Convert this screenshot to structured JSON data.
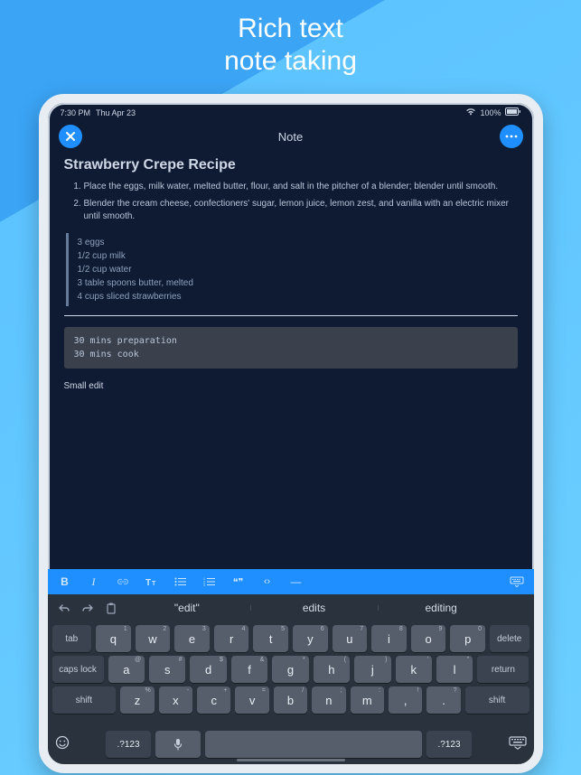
{
  "promo": {
    "line1": "Rich text",
    "line2": "note taking"
  },
  "status": {
    "time": "7:30 PM",
    "date": "Thu Apr 23",
    "battery_pct": "100%"
  },
  "nav": {
    "title": "Note"
  },
  "note": {
    "title": "Strawberry Crepe Recipe",
    "steps": [
      "Place the eggs, milk water, melted butter, flour, and salt in the pitcher of a blender; blender until smooth.",
      "Blender the cream cheese, confectioners' sugar, lemon juice, lemon zest, and vanilla with an electric mixer until smooth."
    ],
    "ingredients": [
      "3 eggs",
      "1/2 cup milk",
      "1/2 cup water",
      "3 table spoons butter, melted",
      "4 cups sliced strawberries"
    ],
    "code": "30 mins preparation\n30 mins cook",
    "footer": "Small edit"
  },
  "toolbar": {
    "bold": "B",
    "italic": "I",
    "quote": "❝❞",
    "code": "‹›",
    "hr": "—"
  },
  "suggestions": {
    "s1": "\"edit\"",
    "s2": "edits",
    "s3": "editing"
  },
  "keyboard": {
    "row1": [
      "q",
      "w",
      "e",
      "r",
      "t",
      "y",
      "u",
      "i",
      "o",
      "p"
    ],
    "row1_sub": [
      "1",
      "2",
      "3",
      "4",
      "5",
      "6",
      "7",
      "8",
      "9",
      "0"
    ],
    "row2": [
      "a",
      "s",
      "d",
      "f",
      "g",
      "h",
      "j",
      "k",
      "l"
    ],
    "row2_sub": [
      "@",
      "#",
      "$",
      "&",
      "*",
      "(",
      ")",
      "'",
      "\""
    ],
    "row3": [
      "z",
      "x",
      "c",
      "v",
      "b",
      "n",
      "m",
      ",",
      "."
    ],
    "row3_sub": [
      "%",
      "-",
      "+",
      "=",
      "/",
      ";",
      ":",
      "!",
      "?"
    ],
    "tab": "tab",
    "delete": "delete",
    "caps": "caps lock",
    "return": "return",
    "shift": "shift",
    "numsym": ".?123"
  }
}
